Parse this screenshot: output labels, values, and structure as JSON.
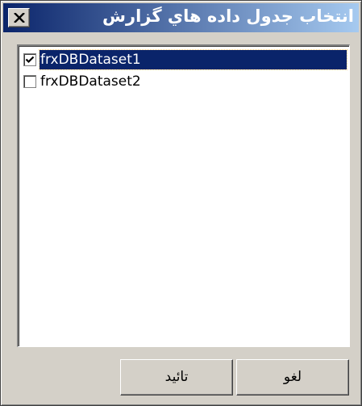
{
  "window": {
    "title": "انتخاب جدول داده هاي گزارش",
    "close_glyph": "close-icon"
  },
  "list": {
    "items": [
      {
        "label": "frxDBDataset1",
        "checked": true,
        "selected": true
      },
      {
        "label": "frxDBDataset2",
        "checked": false,
        "selected": false
      }
    ]
  },
  "buttons": {
    "ok_label": "تائيد",
    "cancel_label": "لغو"
  },
  "colors": {
    "title_start": "#0a246a",
    "title_end": "#a6caf0",
    "selection": "#0a246a",
    "face": "#d4d0c8"
  }
}
